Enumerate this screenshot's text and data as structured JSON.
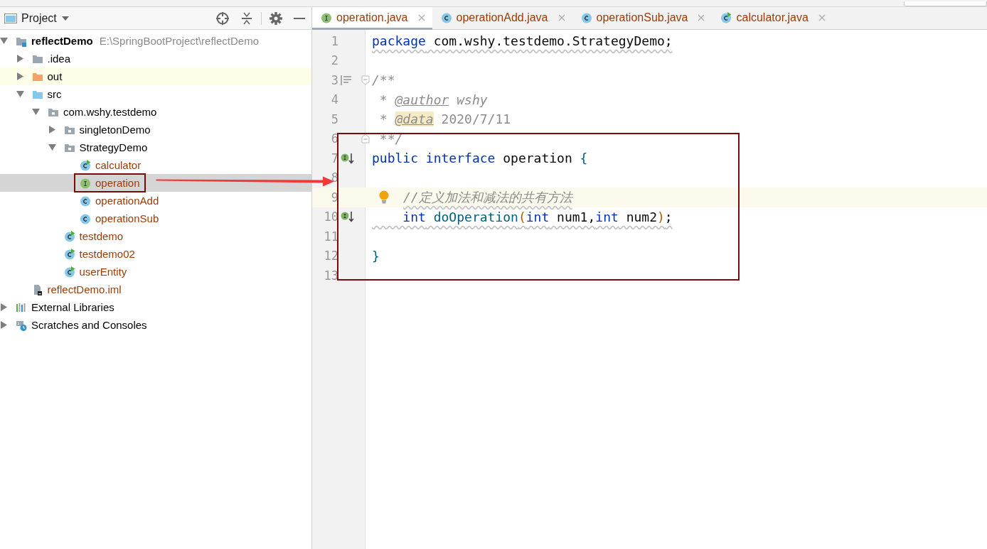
{
  "project_panel": {
    "title": "Project",
    "tree": [
      {
        "label": "reflectDemo",
        "path": "E:\\SpringBootProject\\reflectDemo",
        "kind": "module",
        "expanded": true,
        "selected": false,
        "unversioned": false,
        "outlined": false,
        "children": [
          {
            "label": ".idea",
            "kind": "folder",
            "expanded": false,
            "selected": false,
            "unversioned": false,
            "outlined": false
          },
          {
            "label": "out",
            "kind": "excluded-folder",
            "expanded": false,
            "selected": false,
            "unversioned": false,
            "outlined": false
          },
          {
            "label": "src",
            "kind": "source-folder",
            "expanded": true,
            "selected": false,
            "unversioned": false,
            "outlined": false,
            "children": [
              {
                "label": "com.wshy.testdemo",
                "kind": "package",
                "expanded": true,
                "selected": false,
                "unversioned": false,
                "outlined": false,
                "children": [
                  {
                    "label": "singletonDemo",
                    "kind": "package",
                    "expanded": false,
                    "selected": false,
                    "unversioned": false,
                    "outlined": false
                  },
                  {
                    "label": "StrategyDemo",
                    "kind": "package",
                    "expanded": true,
                    "selected": false,
                    "unversioned": false,
                    "outlined": false,
                    "children": [
                      {
                        "label": "calculator",
                        "kind": "runnable-class",
                        "selected": false,
                        "unversioned": true,
                        "outlined": false
                      },
                      {
                        "label": "operation",
                        "kind": "interface",
                        "selected": true,
                        "unversioned": true,
                        "outlined": true
                      },
                      {
                        "label": "operationAdd",
                        "kind": "class",
                        "selected": false,
                        "unversioned": true,
                        "outlined": false
                      },
                      {
                        "label": "operationSub",
                        "kind": "class",
                        "selected": false,
                        "unversioned": true,
                        "outlined": false
                      }
                    ]
                  },
                  {
                    "label": "testdemo",
                    "kind": "runnable-class",
                    "selected": false,
                    "unversioned": true,
                    "outlined": false
                  },
                  {
                    "label": "testdemo02",
                    "kind": "runnable-class",
                    "selected": false,
                    "unversioned": true,
                    "outlined": false
                  },
                  {
                    "label": "userEntity",
                    "kind": "runnable-class",
                    "selected": false,
                    "unversioned": true,
                    "outlined": false
                  }
                ]
              }
            ]
          },
          {
            "label": "reflectDemo.iml",
            "kind": "iml-file",
            "selected": false,
            "unversioned": true,
            "outlined": false
          }
        ]
      },
      {
        "label": "External Libraries",
        "kind": "libraries",
        "expanded": false,
        "selected": false,
        "unversioned": false,
        "outlined": false
      },
      {
        "label": "Scratches and Consoles",
        "kind": "scratches",
        "expanded": false,
        "selected": false,
        "unversioned": false,
        "outlined": false
      }
    ]
  },
  "editor": {
    "tabs": [
      {
        "label": "operation.java",
        "kind": "interface",
        "selected": true
      },
      {
        "label": "operationAdd.java",
        "kind": "class",
        "selected": false
      },
      {
        "label": "operationSub.java",
        "kind": "class",
        "selected": false
      },
      {
        "label": "calculator.java",
        "kind": "runnable-class",
        "selected": false
      }
    ],
    "lines": [
      {
        "number": "1",
        "current": false,
        "wavy": true,
        "tokens": [
          {
            "kind": "keyword",
            "text": "package"
          },
          {
            "kind": "plain",
            "text": " com.wshy.testdemo.StrategyDemo;"
          }
        ]
      },
      {
        "number": "2",
        "current": false
      },
      {
        "number": "3",
        "markers": [
          {
            "kind": "doc"
          },
          {
            "kind": "fold-start"
          }
        ],
        "current": false,
        "wavy": false,
        "tokens": [
          {
            "kind": "comment",
            "text": "/**"
          }
        ]
      },
      {
        "number": "4",
        "current": false,
        "wavy": false,
        "tokens": [
          {
            "kind": "comment",
            "text": " * "
          },
          {
            "kind": "doc-tag",
            "text": "@author"
          },
          {
            "kind": "comment",
            "text": " wshy"
          }
        ]
      },
      {
        "number": "5",
        "current": false,
        "wavy": false,
        "tokens": [
          {
            "kind": "comment",
            "text": " * "
          },
          {
            "kind": "doc-tag-marked",
            "text": "@data"
          },
          {
            "kind": "doc-text",
            "text": " 2020/7/11"
          }
        ]
      }
    ],
    "boxed_lines": [
      {
        "number": "6",
        "markers": [
          {
            "kind": "fold-end"
          }
        ],
        "current": false,
        "wavy": false,
        "tokens": [
          {
            "kind": "comment",
            "text": " **/"
          }
        ]
      },
      {
        "number": "7",
        "markers": [
          {
            "kind": "implemented"
          }
        ],
        "current": false,
        "wavy": false,
        "tokens": [
          {
            "kind": "keyword",
            "text": "public interface"
          },
          {
            "kind": "plain",
            "text": " operation "
          },
          {
            "kind": "brace",
            "text": "{"
          }
        ]
      },
      {
        "number": "8",
        "current": false
      },
      {
        "number": "9",
        "markers": [
          {
            "kind": "bulb"
          }
        ],
        "current": true,
        "wavy": true,
        "tokens": [
          {
            "kind": "comment",
            "text": "//定义加法和减法的共有方法"
          }
        ]
      },
      {
        "number": "10",
        "markers": [
          {
            "kind": "implemented"
          }
        ],
        "current": false,
        "wavy": true,
        "tokens": [
          {
            "kind": "keyword",
            "text": "    int"
          },
          {
            "kind": "method",
            "text": " doOperation"
          },
          {
            "kind": "paren",
            "text": "("
          },
          {
            "kind": "keyword",
            "text": "int"
          },
          {
            "kind": "plain",
            "text": " num1,"
          },
          {
            "kind": "keyword",
            "text": "int"
          },
          {
            "kind": "plain",
            "text": " num2"
          },
          {
            "kind": "paren",
            "text": ")"
          },
          {
            "kind": "plain",
            "text": ";"
          }
        ]
      },
      {
        "number": "11",
        "current": false
      },
      {
        "number": "12",
        "current": false,
        "wavy": false,
        "tokens": [
          {
            "kind": "brace",
            "text": "}"
          }
        ]
      },
      {
        "number": "13",
        "current": false
      }
    ]
  },
  "annotation_arrow": true
}
